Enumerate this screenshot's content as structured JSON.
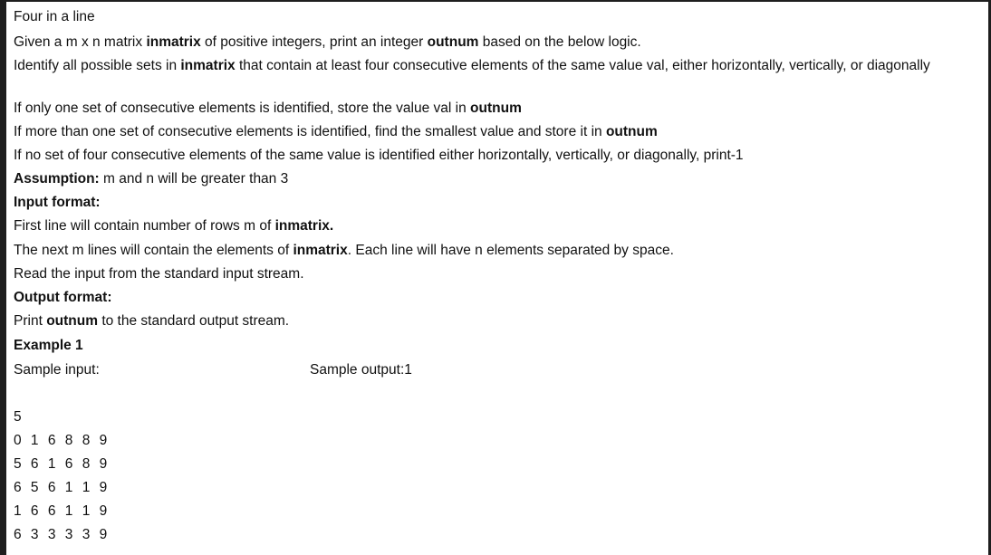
{
  "document": {
    "lines": [
      [
        {
          "t": "Four in a line"
        }
      ],
      [
        {
          "t": "Given a m x n matrix "
        },
        {
          "t": "inmatrix",
          "b": true
        },
        {
          "t": " of positive integers, print an integer "
        },
        {
          "t": "outnum",
          "b": true
        },
        {
          "t": " based on the below logic."
        }
      ],
      [
        {
          "t": "Identify all possible sets in "
        },
        {
          "t": "inmatrix",
          "b": true
        },
        {
          "t": " that contain at least four consecutive elements of the same value val, either horizontally, vertically, or diagonally"
        }
      ],
      [
        {
          "t": "If only one set of consecutive elements is identified, store the value val in "
        },
        {
          "t": "outnum",
          "b": true
        }
      ],
      [
        {
          "t": "If more than one set of consecutive elements is identified, find the smallest value and store it in "
        },
        {
          "t": "outnum",
          "b": true
        }
      ],
      [
        {
          "t": "If no set of four consecutive elements of the same value is identified either horizontally, vertically, or diagonally, print-1"
        }
      ],
      [
        {
          "t": "Assumption:",
          "b": true
        },
        {
          "t": " m and n will be greater than 3"
        }
      ],
      [
        {
          "t": "Input format:",
          "b": true
        }
      ],
      [
        {
          "t": "First line will contain number of rows m of "
        },
        {
          "t": "inmatrix.",
          "b": true
        }
      ],
      [
        {
          "t": "The next m lines will contain the elements of "
        },
        {
          "t": "inmatrix",
          "b": true
        },
        {
          "t": ". Each line will have n elements separated by space."
        }
      ],
      [
        {
          "t": "Read the input from the standard input stream."
        }
      ],
      [
        {
          "t": "Output format:",
          "b": true
        }
      ],
      [
        {
          "t": "Print "
        },
        {
          "t": "outnum",
          "b": true
        },
        {
          "t": " to the standard output stream."
        }
      ],
      [
        {
          "t": "Example 1",
          "b": true
        }
      ]
    ],
    "sample_input_label": "Sample input:",
    "sample_output_label": "Sample output:1",
    "sample_input": [
      "5",
      "0 1 6 8 8 9",
      "5 6 1 6 8 9",
      "6 5 6 1 1 9",
      "1 6 6 1 1 9",
      "6 3 3 3 3 9"
    ]
  }
}
